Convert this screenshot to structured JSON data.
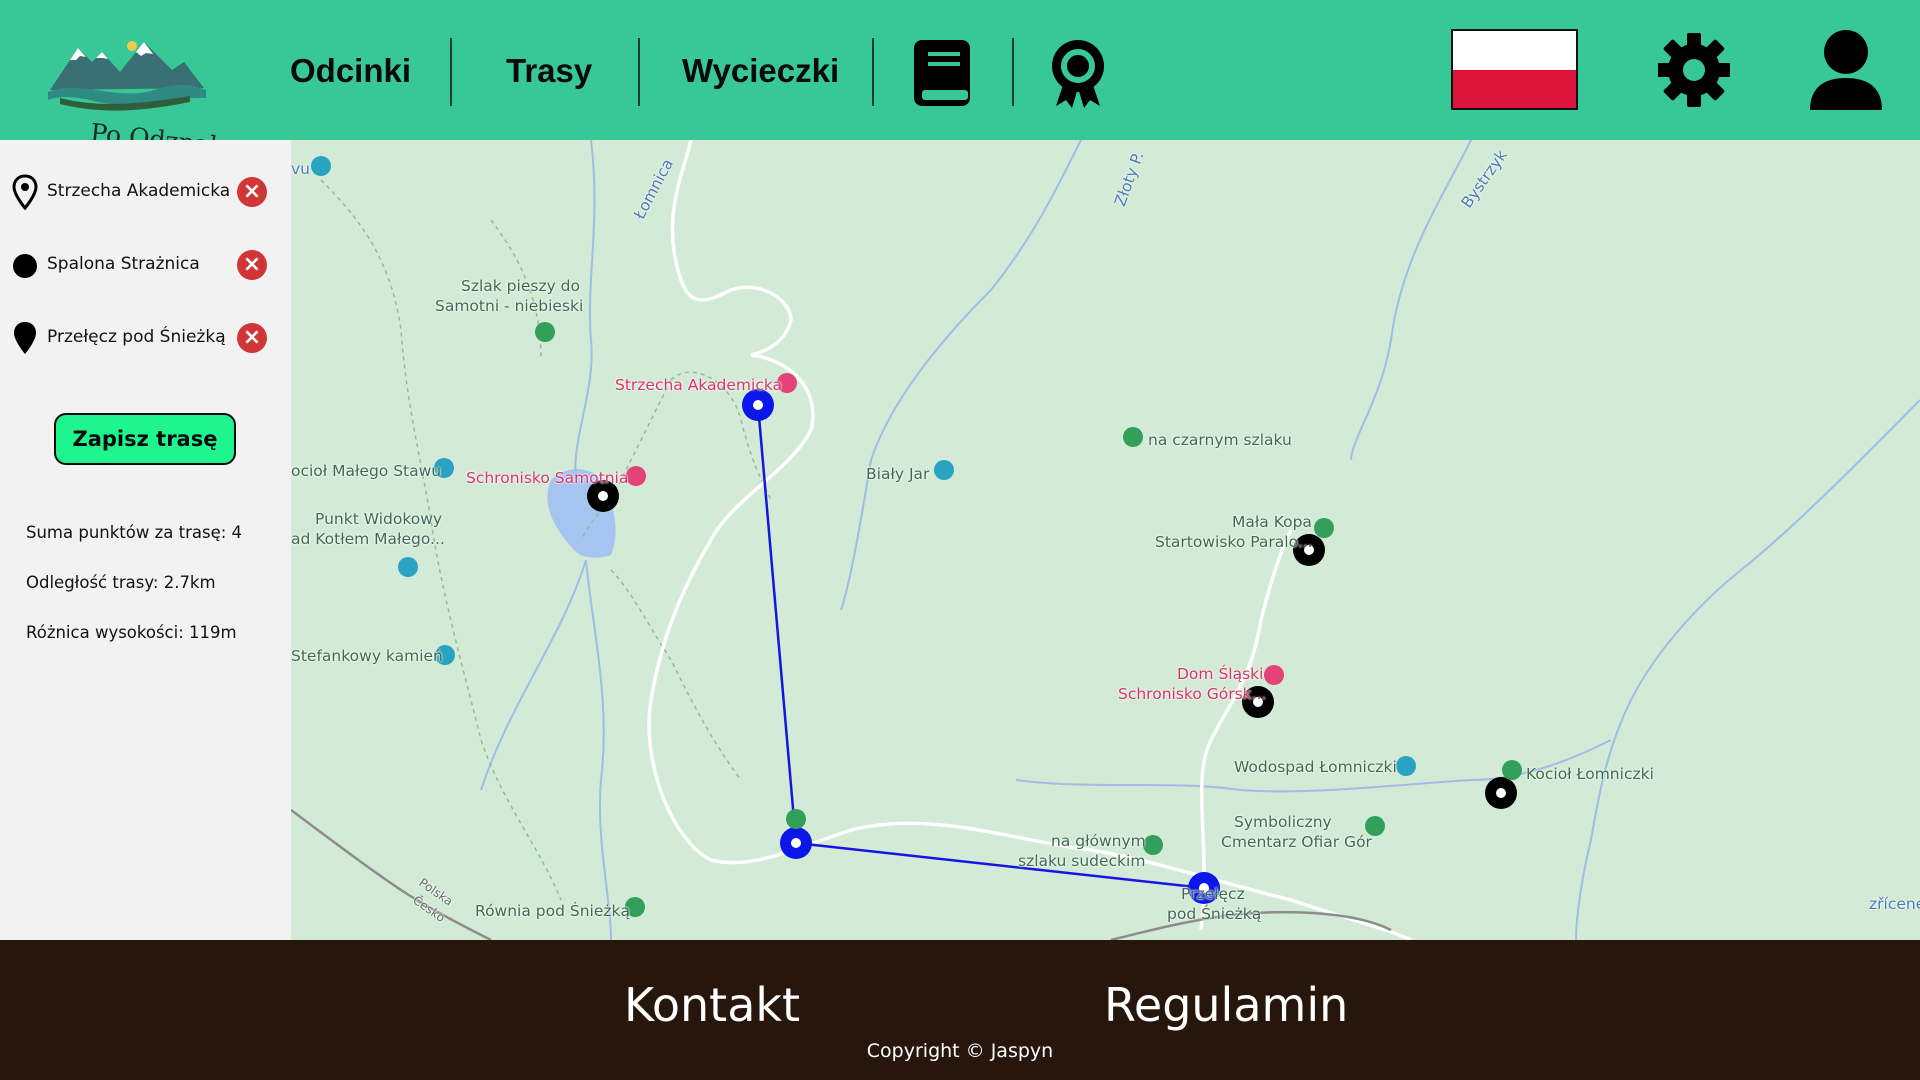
{
  "header": {
    "logo_text": "Po Odznakę",
    "nav": {
      "odcinki": "Odcinki",
      "trasy": "Trasy",
      "wycieczki": "Wycieczki"
    },
    "icons": [
      "book-icon",
      "award-badge-icon",
      "polish-flag",
      "gear-icon",
      "user-icon"
    ],
    "colors": {
      "header_bg": "#38c796",
      "footer_bg": "#27160c",
      "accent": "#1ef58e"
    }
  },
  "sidebar": {
    "points": [
      {
        "label": "Strzecha Akademicka",
        "pin": "start-pin-outline"
      },
      {
        "label": "Spalona Strażnica",
        "pin": "dot"
      },
      {
        "label": "Przełęcz pod Śnieżką",
        "pin": "end-pin-filled"
      }
    ],
    "save_label": "Zapisz trasę",
    "stats": {
      "points": "Suma punktów za trasę: 4",
      "distance": "Odległość trasy: 2.7km",
      "elevation": "Różnica wysokości: 119m"
    }
  },
  "map": {
    "labels": {
      "szlak_pieszy": "Szlak pieszy do",
      "samotni_niebieski": "Samotni - niebieski",
      "strzecha": "Strzecha Akademicka",
      "schronisko_samotnia": "Schronisko Samotnia",
      "kociol_malego": "ocioł Małego Stawu",
      "punkt_widokowy": "Punkt Widokowy",
      "nad_kotlem": "ad Kotłem Małego...",
      "bialy_jar": "Biały Jar",
      "na_czarnym": "na czarnym szlaku",
      "mala_kopa": "Mała Kopa",
      "startowisko": "Startowisko Paralo...",
      "stefankowy": "Stefankowy kamień",
      "dom_slaski": "Dom Śląski",
      "schronisko_gorskie": "Schronisko Górsk...",
      "wodospad": "Wodospad Łomniczki",
      "kociol_lomniczki": "Kocioł Łomniczki",
      "symboliczny": "Symboliczny",
      "cmentarz": "Cmentarz Ofiar Gór",
      "na_glownym": "na głównym",
      "szlaku_sudeckim": "szlaku sudeckim",
      "przelecz1": "Przełęcz",
      "przelecz2": "pod Śnieżką",
      "rownia": "Równia pod Śnieżką",
      "lomnica": "Łomnica",
      "zloty": "Złoty P.",
      "bystrzyk": "Bystrzyk",
      "wu": "vu",
      "polska": "Polska",
      "cesko": "Česko",
      "zricene": "zřícene"
    }
  },
  "footer": {
    "kontakt": "Kontakt",
    "regulamin": "Regulamin",
    "copyright": "Copyright © Jaspyn"
  }
}
